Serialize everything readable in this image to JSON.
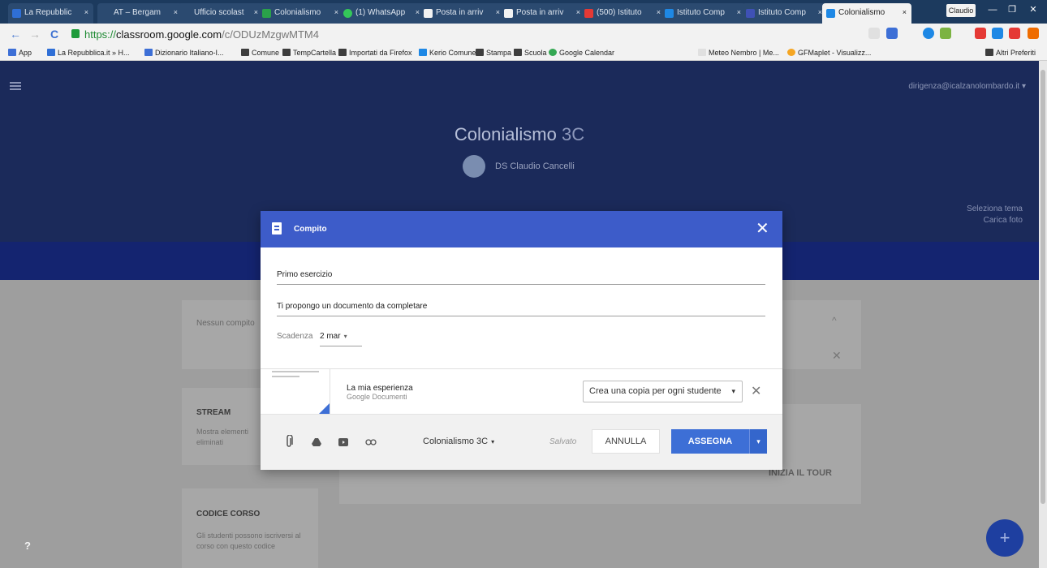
{
  "browser": {
    "tabs": [
      {
        "title": "La Repubblic",
        "favicon_color": "#2f6fd6"
      },
      {
        "title": "AT – Bergam",
        "favicon_color": "#cccccc"
      },
      {
        "title": "Ufficio scolast",
        "favicon_color": "#cccccc"
      },
      {
        "title": "Colonialismo",
        "favicon_color": "#2aa14a"
      },
      {
        "title": "(1) WhatsApp",
        "favicon_color": "#34c759"
      },
      {
        "title": "Posta in arriv",
        "favicon_color": "#f2f2f2"
      },
      {
        "title": "Posta in arriv",
        "favicon_color": "#f2f2f2"
      },
      {
        "title": "(500) Istituto",
        "favicon_color": "#e53935"
      },
      {
        "title": "Istituto Comp",
        "favicon_color": "#1e88e5"
      },
      {
        "title": "Istituto Comp",
        "favicon_color": "#3f51b5"
      },
      {
        "title": "Colonialismo",
        "favicon_color": "#1e88e5"
      }
    ],
    "tab_close": "×",
    "user_name": "Claudio",
    "window_buttons": [
      "—",
      "❐",
      "✕"
    ],
    "nav": {
      "back": "←",
      "forward": "→",
      "reload": "C"
    },
    "url": {
      "scheme": "https://",
      "host": "classroom.google.com",
      "path": "/c/ODUzMzgwMTM4"
    },
    "bookmarks": [
      {
        "label": "App",
        "type": "apps"
      },
      {
        "label": "La Repubblica.it » H...",
        "type": "site"
      },
      {
        "label": "Dizionario Italiano-I...",
        "type": "site"
      },
      {
        "label": "Comune",
        "type": "folder"
      },
      {
        "label": "TempCartella",
        "type": "folder"
      },
      {
        "label": "Importati da Firefox",
        "type": "folder"
      },
      {
        "label": "Kerio Comune",
        "type": "site"
      },
      {
        "label": "Stampa",
        "type": "folder"
      },
      {
        "label": "Scuola",
        "type": "folder"
      },
      {
        "label": "Google Calendar",
        "type": "site"
      },
      {
        "label": "Meteo Nembro | Me...",
        "type": "site"
      },
      {
        "label": "GFMaplet - Visualizz...",
        "type": "site"
      },
      {
        "label": "Altri Preferiti",
        "type": "folder"
      }
    ]
  },
  "classroom": {
    "course_name": "Colonialismo",
    "course_section": "3C",
    "teacher": "DS Claudio Cancelli",
    "account": "dirigenza@icalzanolombardo.it ▾",
    "theme_select": "Seleziona tema",
    "upload_photo": "Carica foto",
    "no_upcoming": "Nessun compito",
    "stream_title": "STREAM",
    "stream_desc": "Mostra elementi eliminati",
    "code_title": "CODICE CORSO",
    "code_desc": "Gli studenti possono iscriversi al corso con questo codice",
    "tour_button": "INIZIA IL TOUR",
    "fab": "+",
    "help": "?",
    "collapse_icon": "^",
    "card_close": "✕"
  },
  "dialog": {
    "title": "Compito",
    "close": "✕",
    "assignment_title": "Primo esercizio",
    "instructions": "Ti propongo un documento da completare",
    "due_label": "Scadenza",
    "due_value": "2 mar",
    "attachment": {
      "name": "La mia esperienza",
      "type": "Google Documenti",
      "share_mode": "Crea una copia per ogni studente",
      "remove": "✕"
    },
    "class_select": "Colonialismo 3C",
    "status": "Salvato",
    "cancel": "ANNULLA",
    "assign": "ASSEGNA",
    "caret": "▾"
  }
}
